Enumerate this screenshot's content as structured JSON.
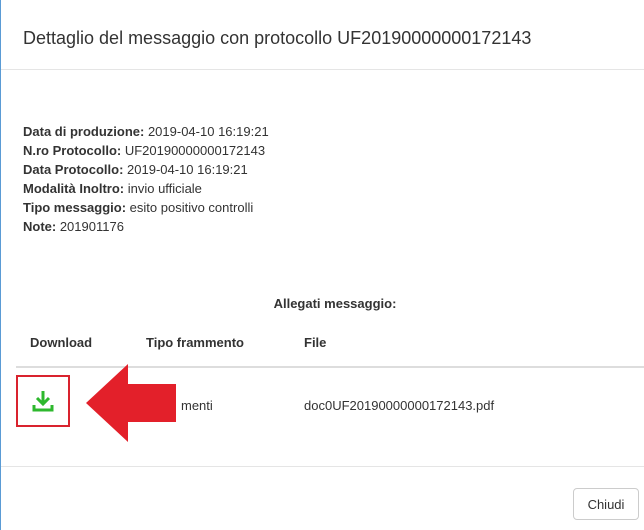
{
  "modal": {
    "title": "Dettaglio del messaggio con protocollo UF20190000000172143"
  },
  "details": [
    {
      "label": "Data di produzione:",
      "value": " 2019-04-10 16:19:21"
    },
    {
      "label": "N.ro Protocollo:",
      "value": " UF20190000000172143"
    },
    {
      "label": "Data Protocollo:",
      "value": " 2019-04-10 16:19:21"
    },
    {
      "label": "Modalità Inoltro:",
      "value": " invio ufficiale"
    },
    {
      "label": "Tipo messaggio:",
      "value": " esito positivo controlli"
    },
    {
      "label": "Note:",
      "value": " 201901176"
    }
  ],
  "attachments": {
    "title": "Allegati messaggio:",
    "columns": [
      "Download",
      "Tipo frammento",
      "File"
    ],
    "rows": [
      {
        "tipo": "menti",
        "file": "doc0UF20190000000172143.pdf",
        "icon": "download-icon"
      }
    ]
  },
  "footer": {
    "close_label": "Chiudi"
  },
  "colors": {
    "highlight": "#d9232e",
    "download_icon": "#2eb82e",
    "modal_border": "#5a9bd5"
  }
}
